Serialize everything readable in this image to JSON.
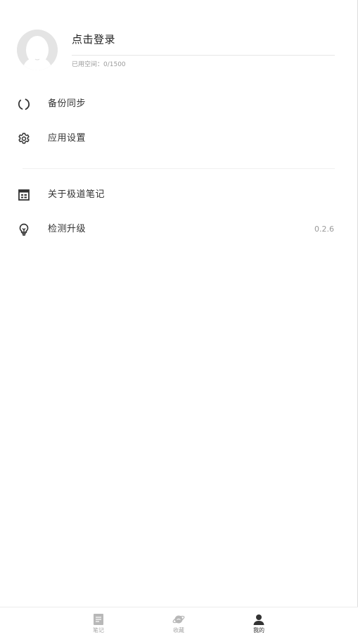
{
  "profile": {
    "login_text": "点击登录",
    "storage_text": "已用空间：0/1500"
  },
  "menu": {
    "items": [
      {
        "label": "备份同步",
        "icon": "sync-icon"
      },
      {
        "label": "应用设置",
        "icon": "gear-icon"
      },
      {
        "label": "关于极道笔记",
        "icon": "about-icon"
      },
      {
        "label": "检测升级",
        "icon": "lightbulb-icon",
        "value": "0.2.6"
      }
    ]
  },
  "tabbar": {
    "tabs": [
      {
        "label": "笔记",
        "icon": "note-icon",
        "active": false
      },
      {
        "label": "收藏",
        "icon": "planet-icon",
        "active": false
      },
      {
        "label": "我的",
        "icon": "person-icon",
        "active": true
      }
    ],
    "active_color": "#333333",
    "inactive_color": "#a8a8a8"
  }
}
